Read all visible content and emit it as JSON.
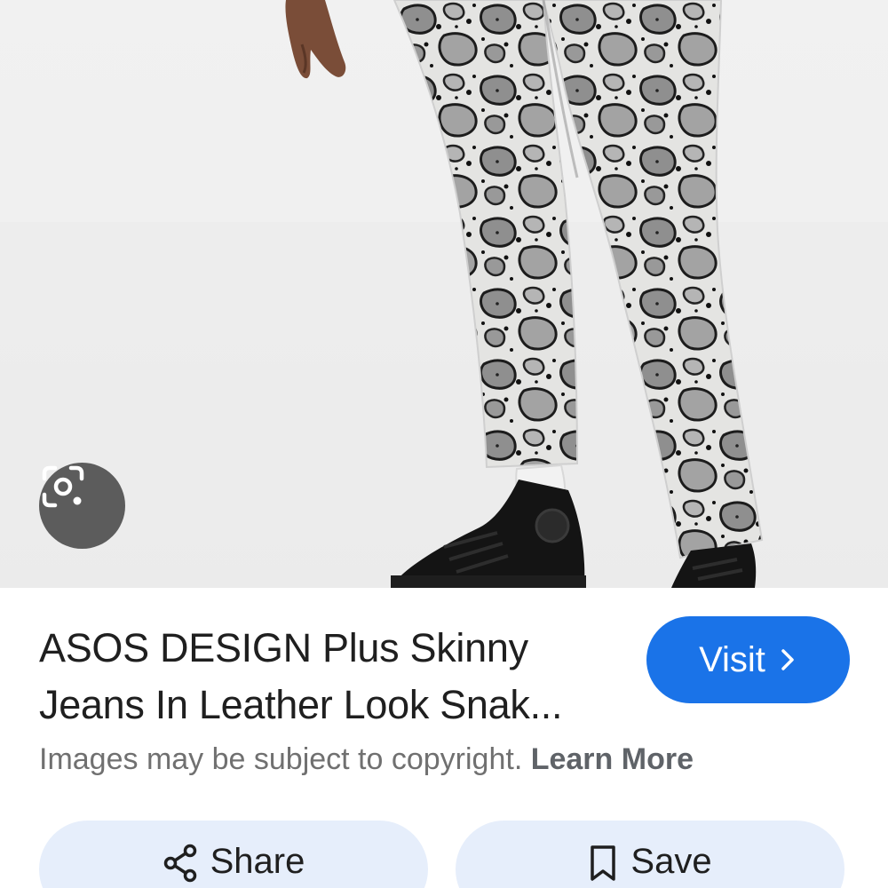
{
  "image": {
    "description_icon": "lens-camera-icon"
  },
  "result": {
    "title": "ASOS DESIGN Plus Skinny Jeans In Leather Look Snak...",
    "visit_label": "Visit",
    "visit_icon": "chevron-right-icon",
    "copyright_text": "Images may be subject to copyright.",
    "learn_more": "Learn More"
  },
  "actions": {
    "share_label": "Share",
    "share_icon": "share-icon",
    "save_label": "Save",
    "save_icon": "bookmark-icon"
  },
  "colors": {
    "accent": "#1a73e8",
    "action_bg": "#e6eefb",
    "lens_bg": "#5c5c5c"
  }
}
